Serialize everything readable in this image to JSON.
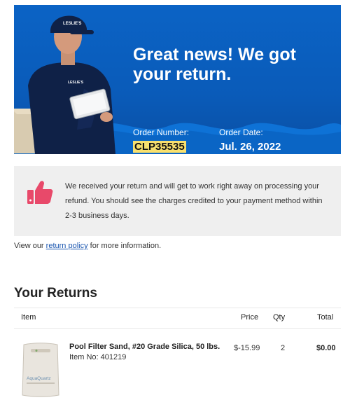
{
  "hero": {
    "headline": "Great news! We got your return.",
    "order_number_label": "Order Number:",
    "order_number": "CLP35535",
    "order_date_label": "Order Date:",
    "order_date": "Jul. 26, 2022",
    "cap_logo_text": "LESLIE'S",
    "shirt_logo_text": "LESLIE'S"
  },
  "notice": {
    "icon": "thumbs-up-icon",
    "text": "We received your return and will get to work right away on processing your refund. You should see the charges credited to your payment method within 2-3 business days."
  },
  "policy": {
    "prefix": "View our",
    "link": "return policy",
    "suffix": "for more information."
  },
  "returns": {
    "title": "Your Returns",
    "columns": {
      "item": "Item",
      "price": "Price",
      "qty": "Qty",
      "total": "Total"
    },
    "items": [
      {
        "name": "Pool Filter Sand, #20 Grade Silica, 50 lbs.",
        "item_no": "Item No: 401219",
        "price": "$-15.99",
        "qty": "2",
        "total": "$0.00",
        "bag_label": "AquaQuartz"
      }
    ]
  },
  "colors": {
    "hero_blue": "#0a5bb9",
    "highlight": "#f8e06e",
    "thumb_pink": "#e8496a",
    "link": "#1a56b0"
  }
}
